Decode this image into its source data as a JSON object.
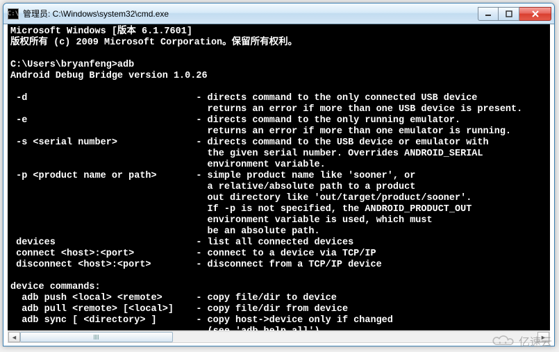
{
  "window": {
    "icon_glyph": "C:\\",
    "title": "管理员: C:\\Windows\\system32\\cmd.exe"
  },
  "console": {
    "header1": "Microsoft Windows [版本 6.1.7601]",
    "header2": "版权所有 (c) 2009 Microsoft Corporation。保留所有权利。",
    "prompt": "C:\\Users\\bryanfeng>adb",
    "version": "Android Debug Bridge version 1.0.26",
    "opts": [
      {
        "flag": " -d",
        "desc": [
          "directs command to the only connected USB device",
          "returns an error if more than one USB device is present."
        ]
      },
      {
        "flag": " -e",
        "desc": [
          "directs command to the only running emulator.",
          "returns an error if more than one emulator is running."
        ]
      },
      {
        "flag": " -s <serial number>",
        "desc": [
          "directs command to the USB device or emulator with",
          "the given serial number. Overrides ANDROID_SERIAL",
          "environment variable."
        ]
      },
      {
        "flag": " -p <product name or path>",
        "desc": [
          "simple product name like 'sooner', or",
          "a relative/absolute path to a product",
          "out directory like 'out/target/product/sooner'.",
          "If -p is not specified, the ANDROID_PRODUCT_OUT",
          "environment variable is used, which must",
          "be an absolute path."
        ]
      },
      {
        "flag": " devices",
        "desc": [
          "list all connected devices"
        ]
      },
      {
        "flag": " connect <host>:<port>",
        "desc": [
          "connect to a device via TCP/IP"
        ]
      },
      {
        "flag": " disconnect <host>:<port>",
        "desc": [
          "disconnect from a TCP/IP device"
        ]
      }
    ],
    "section2_title": "device commands:",
    "dev_cmds": [
      {
        "flag": "  adb push <local> <remote>",
        "desc": [
          "copy file/dir to device"
        ]
      },
      {
        "flag": "  adb pull <remote> [<local>]",
        "desc": [
          "copy file/dir from device"
        ]
      },
      {
        "flag": "  adb sync [ <directory> ]",
        "desc": [
          "copy host->device only if changed",
          "(see 'adb help all')"
        ]
      }
    ]
  },
  "watermark": {
    "text": "亿速云"
  }
}
